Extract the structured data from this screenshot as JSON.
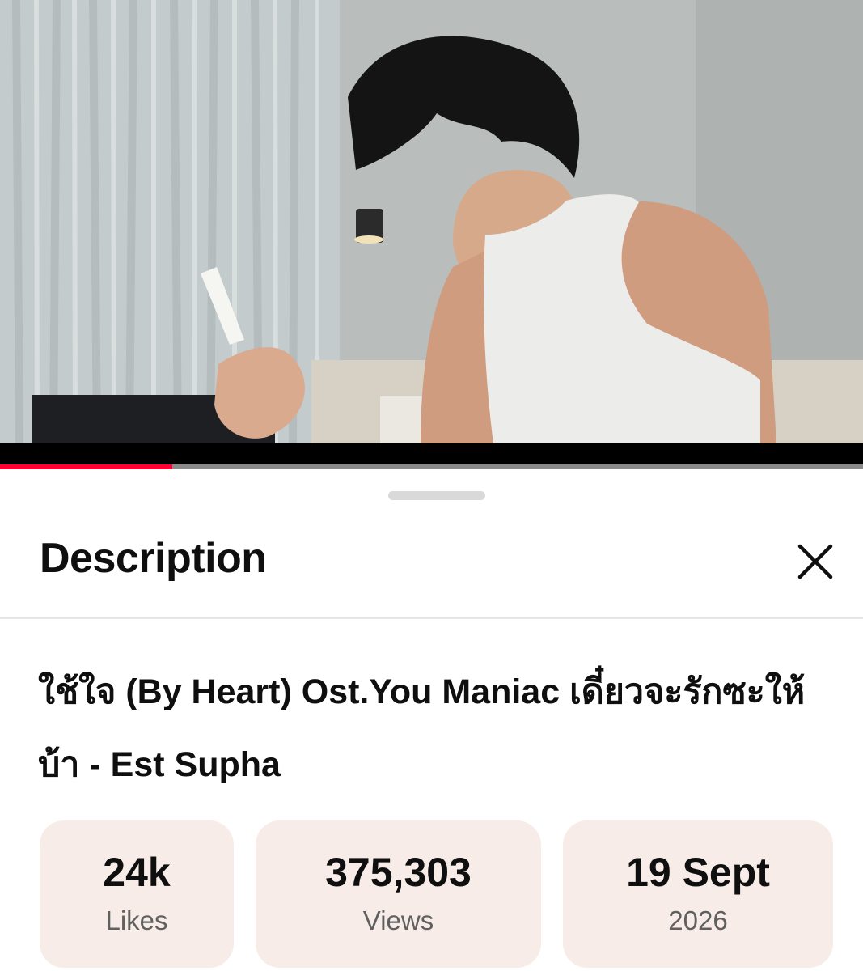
{
  "player": {
    "progress_fraction": 0.2,
    "accent_color": "#ff0033"
  },
  "description_panel": {
    "title": "Description",
    "close_icon": "close-icon",
    "video_title": "ใช้ใจ (By Heart) Ost.You Maniac เดี๋ยวจะรักซะให้บ้า - Est Supha",
    "stats": [
      {
        "value": "24k",
        "label": "Likes"
      },
      {
        "value": "375,303",
        "label": "Views"
      },
      {
        "value": "19 Sept",
        "label": "2026"
      }
    ],
    "stat_background": "#f7ece8"
  }
}
